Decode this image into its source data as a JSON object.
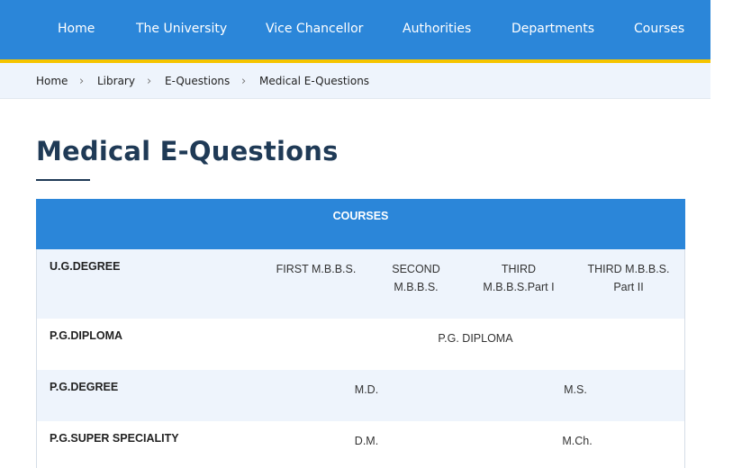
{
  "nav": {
    "items": [
      {
        "label": "Home"
      },
      {
        "label": "The University"
      },
      {
        "label": "Vice Chancellor"
      },
      {
        "label": "Authorities"
      },
      {
        "label": "Departments"
      },
      {
        "label": "Courses"
      }
    ]
  },
  "breadcrumb": {
    "items": [
      "Home",
      "Library",
      "E-Questions",
      "Medical E-Questions"
    ],
    "separator": "›"
  },
  "page": {
    "title": "Medical E-Questions"
  },
  "table": {
    "header": "COURSES",
    "rows": [
      {
        "label": "U.G.DEGREE",
        "links": [
          "FIRST M.B.B.S.",
          "SECOND\nM.B.B.S.",
          "THIRD\nM.B.B.S.Part I",
          "THIRD M.B.B.S.\nPart II"
        ]
      },
      {
        "label": "P.G.DIPLOMA",
        "links": [
          "P.G. DIPLOMA"
        ]
      },
      {
        "label": "P.G.DEGREE",
        "links": [
          "M.D.",
          "M.S."
        ]
      },
      {
        "label": "P.G.SUPER SPECIALITY",
        "links": [
          "D.M.",
          "M.Ch."
        ]
      }
    ]
  },
  "colors": {
    "nav_bg": "#2b86d9",
    "accent_line": "#f5c400",
    "breadcrumb_bg": "#eef4fc",
    "title": "#1f3a56",
    "row_alt": "#eef4fc"
  }
}
